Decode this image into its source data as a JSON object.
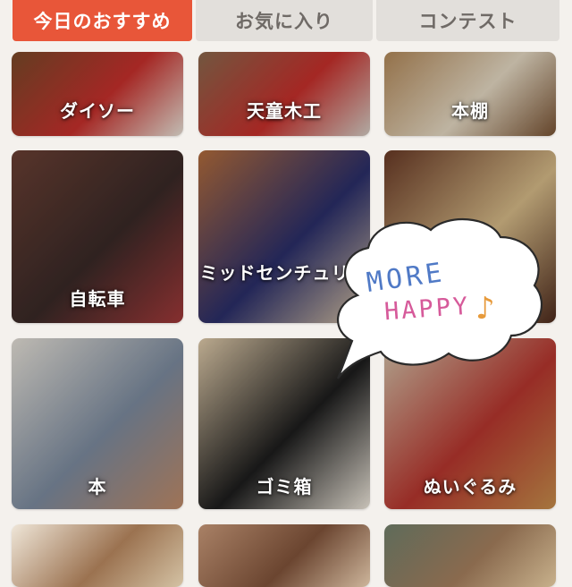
{
  "tabs": [
    {
      "label": "今日のおすすめ",
      "active": true
    },
    {
      "label": "お気に入り",
      "active": false
    },
    {
      "label": "コンテスト",
      "active": false
    }
  ],
  "tiles": [
    {
      "label": "ダイソー",
      "colors": [
        "#7a4b2a",
        "#c9302c",
        "#ede6db"
      ]
    },
    {
      "label": "天童木工",
      "colors": [
        "#8c6a4e",
        "#c9302c",
        "#d8d0c7"
      ]
    },
    {
      "label": "本棚",
      "colors": [
        "#b48a5a",
        "#e8dcc6",
        "#7a5434"
      ]
    },
    {
      "label": "自転車",
      "colors": [
        "#6b4034",
        "#3a2a28",
        "#a43a3a"
      ]
    },
    {
      "label": "ミッドセンチュリー",
      "colors": [
        "#b46d3c",
        "#2b2f6b",
        "#dcc7a6"
      ]
    },
    {
      "label": "",
      "colors": [
        "#6a3a26",
        "#d9bd8a",
        "#4e2b1d"
      ]
    },
    {
      "label": "本",
      "colors": [
        "#e8e3da",
        "#7e8da1",
        "#c28d6a"
      ]
    },
    {
      "label": "ゴミ箱",
      "colors": [
        "#e4cfae",
        "#1d1d1d",
        "#f3ece0"
      ]
    },
    {
      "label": "ぬいぐるみ",
      "colors": [
        "#d7c8ae",
        "#b9372f",
        "#c98f4c"
      ]
    },
    {
      "label": "",
      "colors": [
        "#efe6d8",
        "#9b7250",
        "#d4c2a4"
      ]
    },
    {
      "label": "",
      "colors": [
        "#a98166",
        "#6b4530",
        "#cdb59b"
      ]
    },
    {
      "label": "",
      "colors": [
        "#5f6b5a",
        "#8a6a4e",
        "#c8b18c"
      ]
    }
  ],
  "bubble": {
    "line1": "MORE",
    "line2": "HAPPY",
    "note_icon": "music-note-icon",
    "color_line1": "#4f79c6",
    "color_line2": "#d65a9a",
    "color_note": "#e79a3b"
  }
}
